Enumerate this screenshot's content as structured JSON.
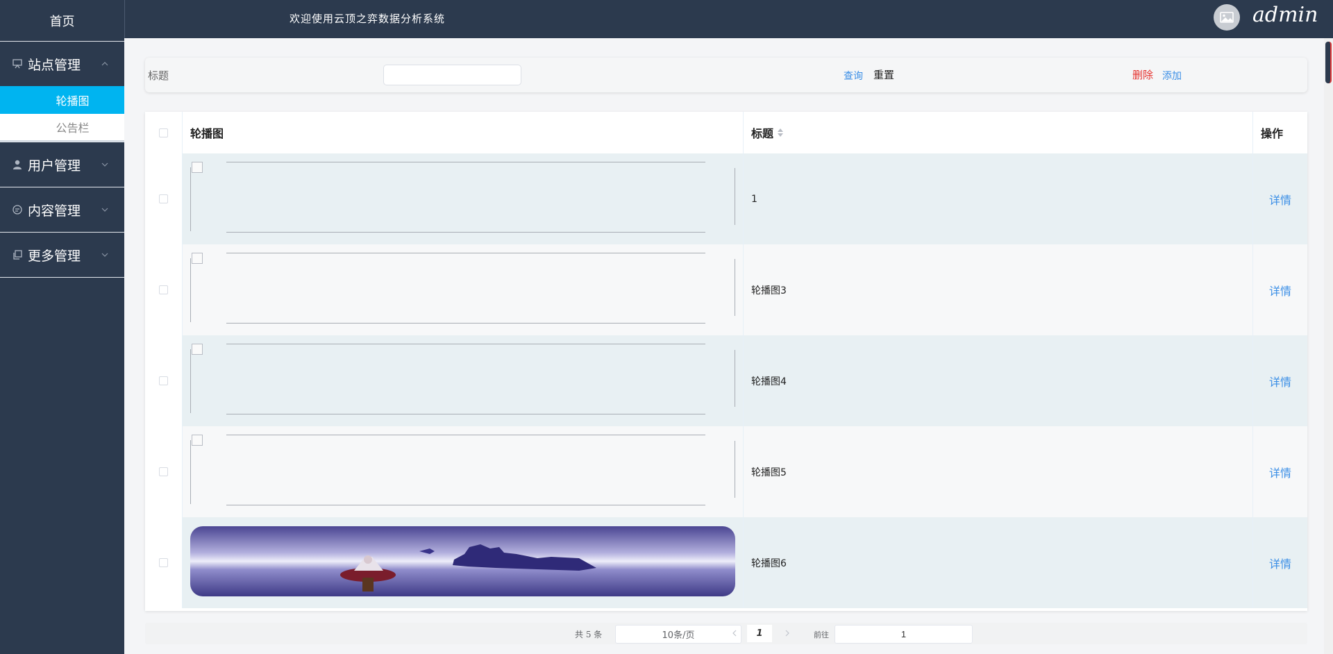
{
  "sidebar": {
    "home": "首页",
    "groups": [
      {
        "label": "站点管理",
        "icon": "easel-icon",
        "expanded": true,
        "items": [
          {
            "label": "轮播图",
            "active": true
          },
          {
            "label": "公告栏",
            "active": false
          }
        ]
      },
      {
        "label": "用户管理",
        "icon": "user-icon",
        "expanded": false
      },
      {
        "label": "内容管理",
        "icon": "chat-icon",
        "expanded": false
      },
      {
        "label": "更多管理",
        "icon": "copy-icon",
        "expanded": false
      }
    ]
  },
  "header": {
    "title": "欢迎使用云顶之弈数据分析系统",
    "username": "admin"
  },
  "search": {
    "label": "标题",
    "value": "",
    "query_label": "查询",
    "reset_label": "重置",
    "delete_label": "删除",
    "add_label": "添加"
  },
  "table": {
    "headers": {
      "image": "轮播图",
      "title": "标题",
      "ops": "操作"
    },
    "rows": [
      {
        "title": "1",
        "image": "broken",
        "detail": "详情"
      },
      {
        "title": "轮播图3",
        "image": "broken",
        "detail": "详情"
      },
      {
        "title": "轮播图4",
        "image": "broken",
        "detail": "详情"
      },
      {
        "title": "轮播图5",
        "image": "broken",
        "detail": "详情"
      },
      {
        "title": "轮播图6",
        "image": "photo",
        "detail": "详情"
      }
    ]
  },
  "pagination": {
    "total_text": "共 5 条",
    "page_size": "10条/页",
    "current_page": "1",
    "goto_label": "前往",
    "goto_value": "1"
  },
  "colors": {
    "sidebar_bg": "#2c3a4e",
    "active": "#00b4f0",
    "link": "#3a8ee6",
    "danger": "#e6322e"
  }
}
